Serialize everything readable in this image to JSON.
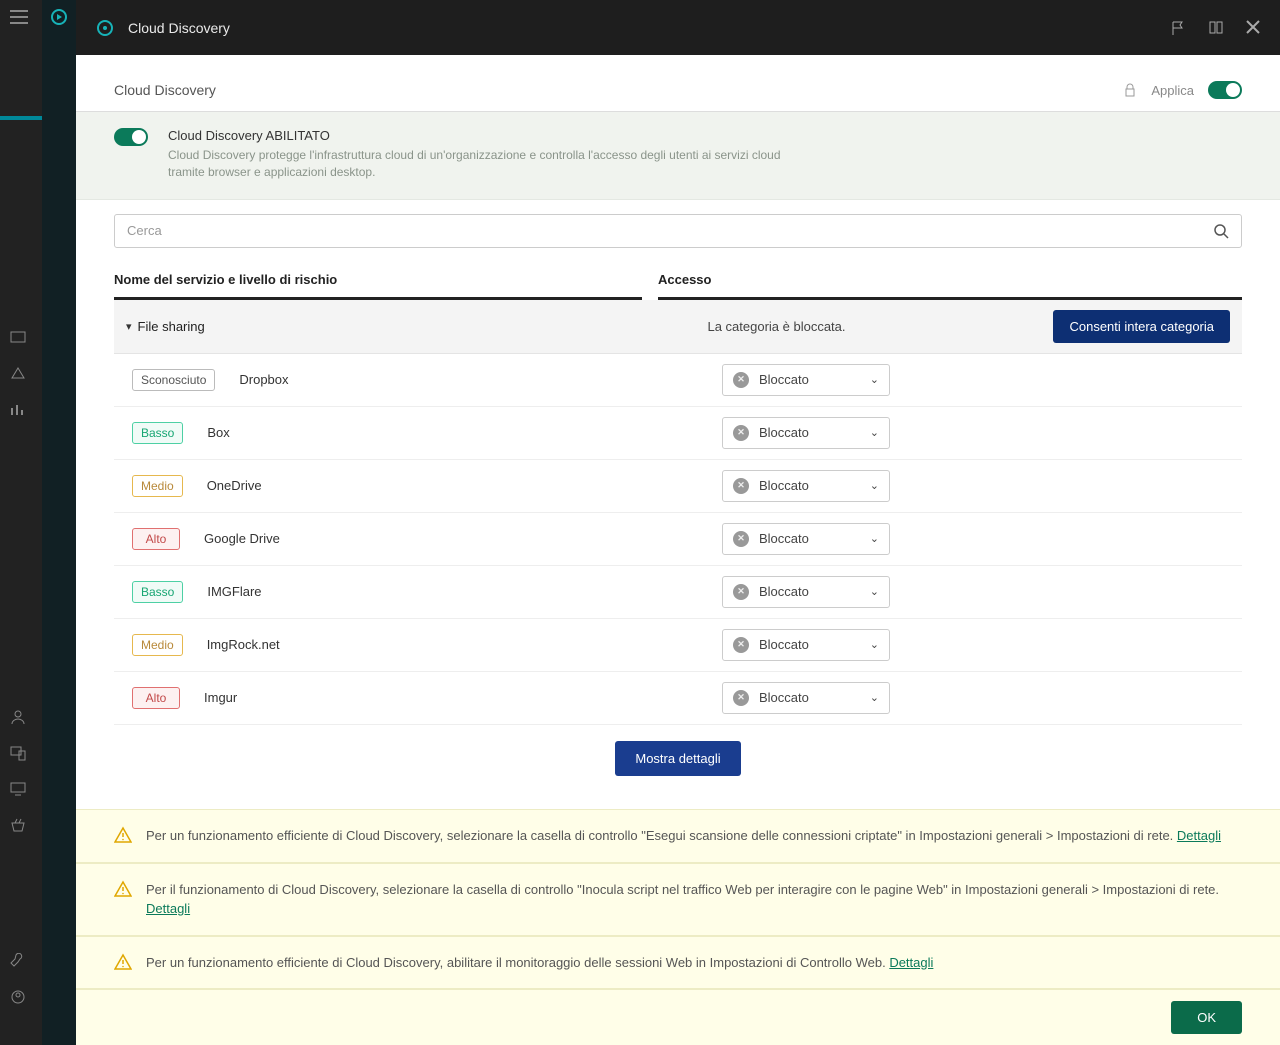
{
  "titlebar": {
    "title": "Cloud Discovery"
  },
  "panel_header": {
    "title": "Cloud Discovery",
    "apply_label": "Applica"
  },
  "enable": {
    "title": "Cloud Discovery ABILITATO",
    "desc": "Cloud Discovery protegge l'infrastruttura cloud di un'organizzazione e controlla l'accesso degli utenti ai servizi cloud tramite browser e applicazioni desktop."
  },
  "search": {
    "placeholder": "Cerca"
  },
  "table": {
    "col_service": "Nome del servizio e livello di rischio",
    "col_access": "Accesso"
  },
  "category": {
    "name": "File sharing",
    "status": "La categoria è bloccata.",
    "allow_label": "Consenti intera categoria"
  },
  "risk_labels": {
    "sconosciuto": "Sconosciuto",
    "basso": "Basso",
    "medio": "Medio",
    "alto": "Alto"
  },
  "access_value": "Bloccato",
  "services": [
    {
      "name": "Dropbox",
      "risk": "sconosciuto"
    },
    {
      "name": "Box",
      "risk": "basso"
    },
    {
      "name": "OneDrive",
      "risk": "medio"
    },
    {
      "name": "Google Drive",
      "risk": "alto"
    },
    {
      "name": "IMGFlare",
      "risk": "basso"
    },
    {
      "name": "ImgRock.net",
      "risk": "medio"
    },
    {
      "name": "Imgur",
      "risk": "alto"
    }
  ],
  "show_details": "Mostra dettagli",
  "warnings": [
    {
      "text": "Per un funzionamento efficiente di Cloud Discovery, selezionare la casella di controllo \"Esegui scansione delle connessioni criptate\" in Impostazioni generali > Impostazioni di rete. ",
      "link": "Dettagli"
    },
    {
      "text": "Per il funzionamento di Cloud Discovery, selezionare la casella di controllo \"Inocula script nel traffico Web per interagire con le pagine Web\" in Impostazioni generali > Impostazioni di rete. ",
      "link": "Dettagli"
    },
    {
      "text": "Per un funzionamento efficiente di Cloud Discovery, abilitare il monitoraggio delle sessioni Web in Impostazioni di Controllo Web. ",
      "link": "Dettagli"
    }
  ],
  "footer": {
    "ok": "OK"
  }
}
